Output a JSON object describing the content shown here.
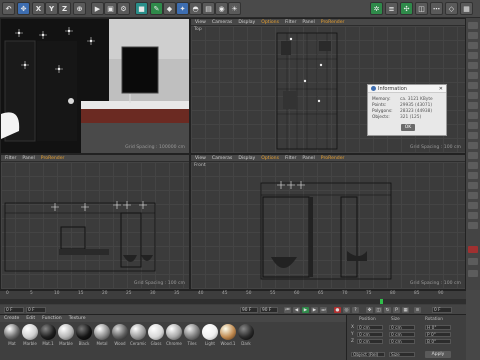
{
  "toolbar": {
    "x_label": "X",
    "y_label": "Y",
    "z_label": "Z"
  },
  "vp_perspective": {
    "menu": [
      "Filter",
      "Panel",
      "ProRender"
    ],
    "grid_spacing": "Grid Spacing : 100000 cm"
  },
  "vp_top": {
    "menu": [
      "View",
      "Cameras",
      "Display",
      "Options",
      "Filter",
      "Panel",
      "ProRender"
    ],
    "label": "Top",
    "grid_spacing": "Grid Spacing : 100 cm"
  },
  "vp_right": {
    "menu": [
      "Filter",
      "Panel",
      "ProRender"
    ],
    "grid_spacing": "Grid Spacing : 100 cm"
  },
  "vp_front": {
    "menu": [
      "View",
      "Cameras",
      "Display",
      "Options",
      "Filter",
      "Panel",
      "ProRender"
    ],
    "label": "Front",
    "grid_spacing": "Grid Spacing : 100 cm"
  },
  "dialog": {
    "title": "Information",
    "rows": [
      {
        "label": "Memory:",
        "value": "ca. 3121 KByte"
      },
      {
        "label": "Points:",
        "value": "29935 (43071)"
      },
      {
        "label": "Polygons:",
        "value": "28323 (44938)"
      },
      {
        "label": "Objects:",
        "value": "321 (125)"
      }
    ],
    "ok_label": "OK"
  },
  "timeline": {
    "ticks": [
      "0",
      "5",
      "10",
      "15",
      "20",
      "25",
      "30",
      "35",
      "40",
      "45",
      "50",
      "55",
      "60",
      "65",
      "70",
      "75",
      "80",
      "85",
      "90"
    ],
    "start_field": "0 F",
    "cur_field": "0 F",
    "end_field": "90 F",
    "end_field2": "90 F",
    "frame_readout": "0 F"
  },
  "materials": {
    "menu": [
      "Create",
      "Edit",
      "Function",
      "Texture"
    ],
    "items": [
      {
        "name": "Mat",
        "color": "#6b6b6b"
      },
      {
        "name": "Marble",
        "color": "#cfcfcf"
      },
      {
        "name": "Mat.1",
        "color": "#1e1e1e"
      },
      {
        "name": "Marble",
        "color": "#b5b5b5"
      },
      {
        "name": "Black",
        "color": "#151515"
      },
      {
        "name": "Metal",
        "color": "#8a8a8a"
      },
      {
        "name": "Wood",
        "color": "#5e5e5e"
      },
      {
        "name": "Ceramic",
        "color": "#9a9a9a"
      },
      {
        "name": "Glass",
        "color": "#d8d8d8"
      },
      {
        "name": "Chrome",
        "color": "#a8a8a8"
      },
      {
        "name": "Tiles",
        "color": "#7a7a7a"
      },
      {
        "name": "Light",
        "color": "#f0f0f0"
      },
      {
        "name": "Wood.1",
        "color": "#c08a50"
      },
      {
        "name": "Dark",
        "color": "#2a2a2a"
      }
    ]
  },
  "coords": {
    "headers": [
      "Position",
      "Size",
      "Rotation"
    ],
    "rows": [
      {
        "axis": "X",
        "pos": "0 cm",
        "size": "0 cm",
        "rot": "H 0°"
      },
      {
        "axis": "Y",
        "pos": "0 cm",
        "size": "0 cm",
        "rot": "P 0°"
      },
      {
        "axis": "Z",
        "pos": "0 cm",
        "size": "0 cm",
        "rot": "B 0°"
      }
    ],
    "mode_object": "Object (Rel)",
    "mode_size": "Size",
    "apply_label": "Apply"
  },
  "colors": {
    "accent": "#e8a030",
    "ui_dark": "#3b3b3b",
    "wood": "#6b2a22"
  }
}
